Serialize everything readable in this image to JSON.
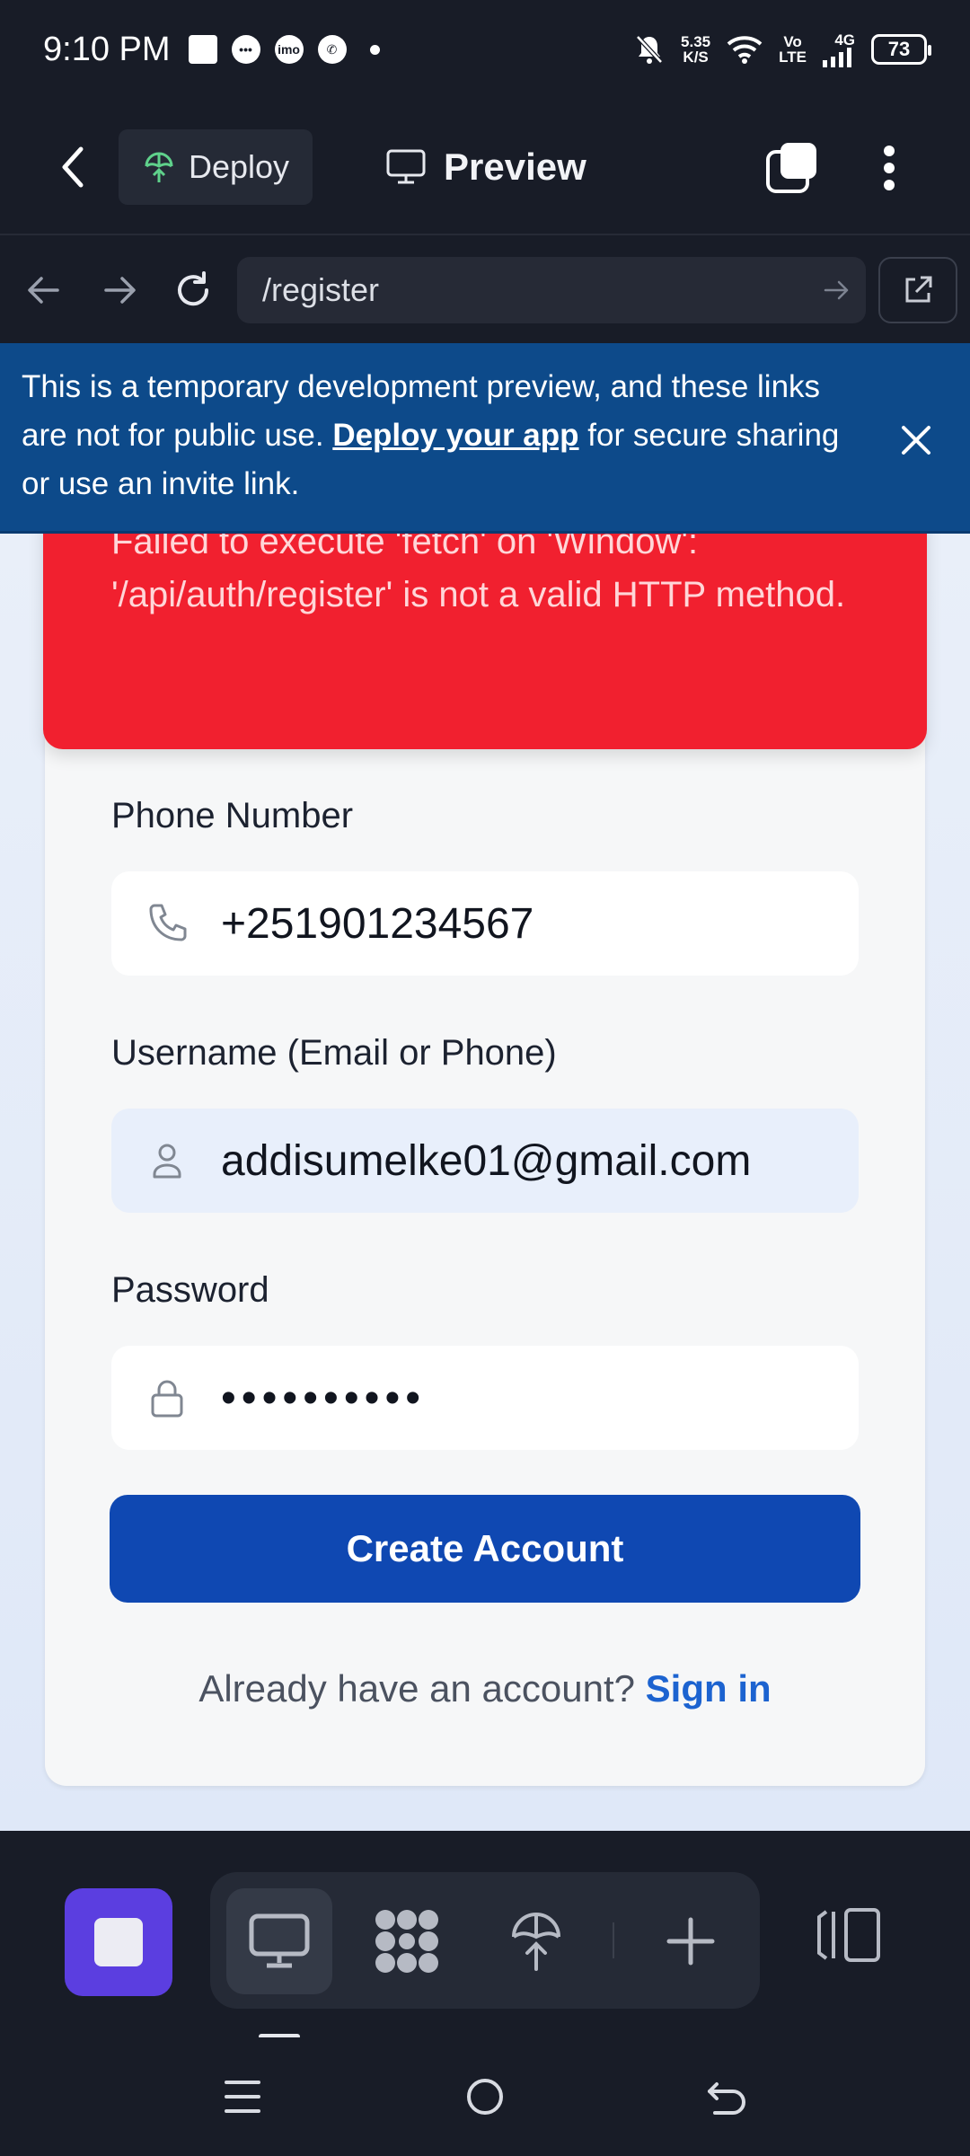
{
  "status_bar": {
    "time": "9:10 PM",
    "net_speed_value": "5.35",
    "net_speed_unit": "K/S",
    "volte_top": "Vo",
    "volte_bottom": "LTE",
    "network": "4G",
    "battery": "73"
  },
  "header": {
    "deploy_label": "Deploy",
    "preview_label": "Preview"
  },
  "url_bar": {
    "path": "/register"
  },
  "banner": {
    "text_before": "This is a temporary development preview, and these links are not for public use. ",
    "link_text": "Deploy your app",
    "text_after": " for secure sharing or use an invite link."
  },
  "error": {
    "message": "Failed to execute 'fetch' on 'Window': '/api/auth/register' is not a valid HTTP method."
  },
  "form": {
    "phone": {
      "label": "Phone Number",
      "value": "+251901234567"
    },
    "username": {
      "label": "Username (Email or Phone)",
      "value": "addisumelke01@gmail.com"
    },
    "password": {
      "label": "Password",
      "masked": "••••••••••"
    },
    "submit_label": "Create Account",
    "signin_prompt": "Already have an account?",
    "signin_link": "Sign in"
  },
  "colors": {
    "accent": "#0f48b2",
    "error": "#f1202f",
    "banner": "#0d4a8a",
    "stop": "#5b3ee0"
  }
}
